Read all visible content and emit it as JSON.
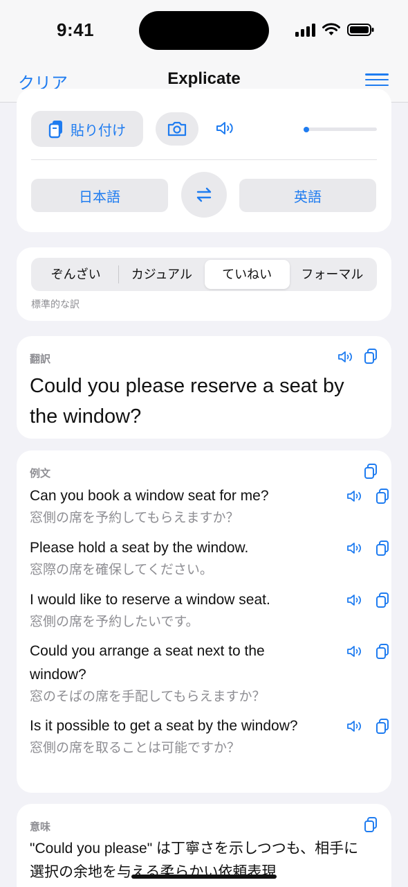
{
  "status": {
    "time": "9:41"
  },
  "nav": {
    "left": "クリア",
    "title": "Explicate"
  },
  "input_card": {
    "paste_label": "貼り付け",
    "slider_value": 0.0,
    "source_lang": "日本語",
    "target_lang": "英語"
  },
  "tone": {
    "options": [
      "ぞんざい",
      "カジュアル",
      "ていねい",
      "フォーマル"
    ],
    "selected": "ていねい",
    "hint": "標準的な訳"
  },
  "translation": {
    "label": "翻訳",
    "text": "Could you please reserve a seat by the window?"
  },
  "examples": {
    "label": "例文",
    "items": [
      {
        "en": "Can you book a window seat for me?",
        "ja": "窓側の席を予約してもらえますか？"
      },
      {
        "en": "Please hold a seat by the window.",
        "ja": "窓際の席を確保してください。"
      },
      {
        "en": "I would like to reserve a window seat.",
        "ja": "窓側の席を予約したいです。"
      },
      {
        "en": "Could you arrange a seat next to the window?",
        "ja": "窓のそばの席を手配してもらえますか？"
      },
      {
        "en": "Is it possible to get a seat by the window?",
        "ja": "窓側の席を取ることは可能ですか？"
      }
    ]
  },
  "meaning": {
    "label": "意味",
    "text": "\"Could you please\" は丁寧さを示しつつも、相手に選択の余地を与える柔らかい依頼表現"
  },
  "colors": {
    "accent": "#1f7cf0",
    "background": "#f2f2f7",
    "secondary_text": "#8e8e93"
  }
}
